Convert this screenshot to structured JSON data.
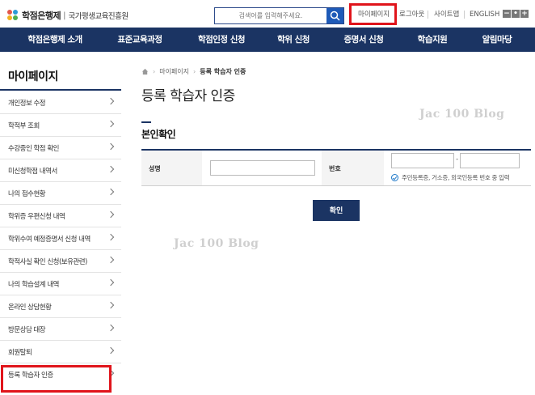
{
  "header": {
    "logo_title": "학점은행제",
    "logo_separator": "|",
    "logo_org": "국가평생교육진흥원",
    "search_placeholder": "검색어를 입력해주세요.",
    "util_links": [
      "마이페이지",
      "로그아웃",
      "사이트맵",
      "ENGLISH"
    ],
    "zoom_controls": [
      "−",
      "•",
      "+"
    ]
  },
  "mainnav": {
    "items": [
      "학점은행제 소개",
      "표준교육과정",
      "학점인정 신청",
      "학위 신청",
      "증명서 신청",
      "학습지원",
      "알림마당"
    ]
  },
  "sidebar": {
    "title": "마이페이지",
    "items": [
      "개인정보 수정",
      "학적부 조회",
      "수강중인 학점 확인",
      "미신청학점 내역서",
      "나의 접수현황",
      "학위증 우편신청 내역",
      "학위수여 예정증명서 신청 내역",
      "학적사실 확인 신청(보유관련)",
      "나의 학습설계 내역",
      "온라인 상담현황",
      "방문상담 대장",
      "회원탈퇴",
      "등록 학습자 인증"
    ],
    "active_item": "등록 학습자 인증"
  },
  "content": {
    "breadcrumb": [
      "마이페이지",
      "등록 학습자 인증"
    ],
    "page_title": "등록 학습자 인증",
    "section_title": "본인확인",
    "form": {
      "name_label": "성명",
      "number_label": "번호",
      "number_separator": "-",
      "hint": "주민등록증, 거소증, 외국인등록 번호 중 입력"
    },
    "confirm_label": "확인"
  },
  "watermarks": [
    "Jac 100 Blog",
    "Jac 100 Blog"
  ],
  "colors": {
    "nav_bg": "#1b3463",
    "highlight_red": "#e0141b",
    "search_blue": "#1e5ab8"
  }
}
